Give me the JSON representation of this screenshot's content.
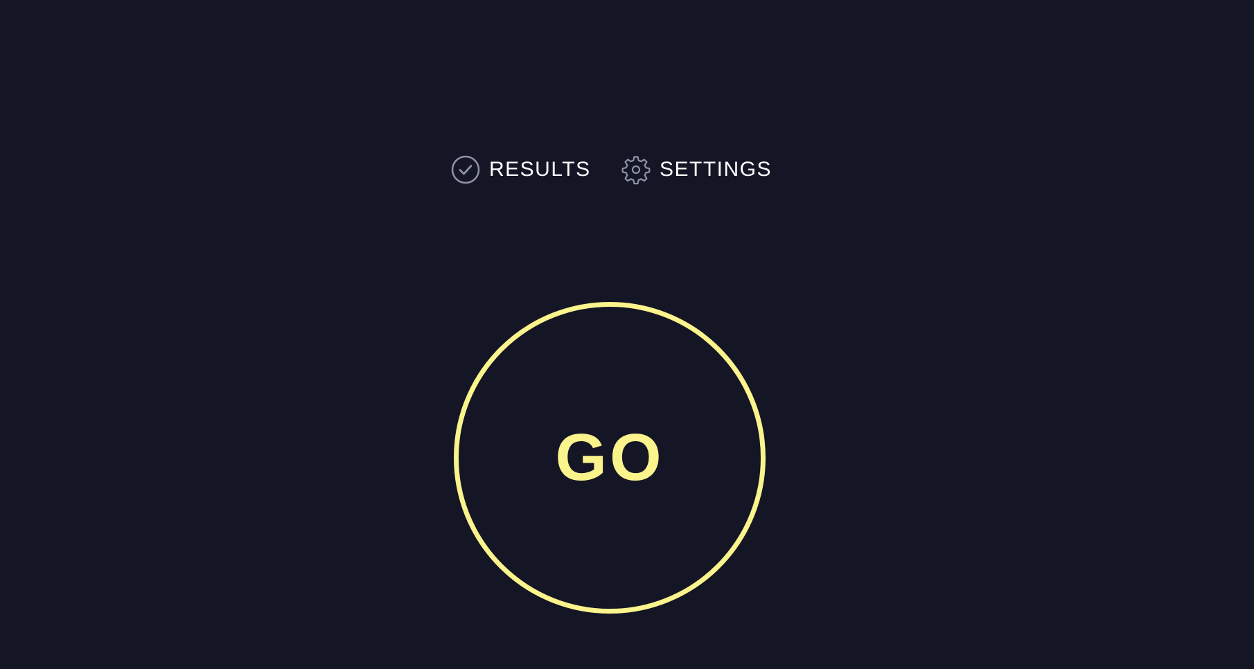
{
  "nav": {
    "results": {
      "label": "RESULTS",
      "icon": "check-circle-icon"
    },
    "settings": {
      "label": "SETTINGS",
      "icon": "gear-icon"
    }
  },
  "main": {
    "go_button_label": "GO"
  },
  "colors": {
    "background": "#141625",
    "accent": "#fbf38c",
    "nav_text": "#ffffff",
    "icon": "#8f92a6"
  }
}
